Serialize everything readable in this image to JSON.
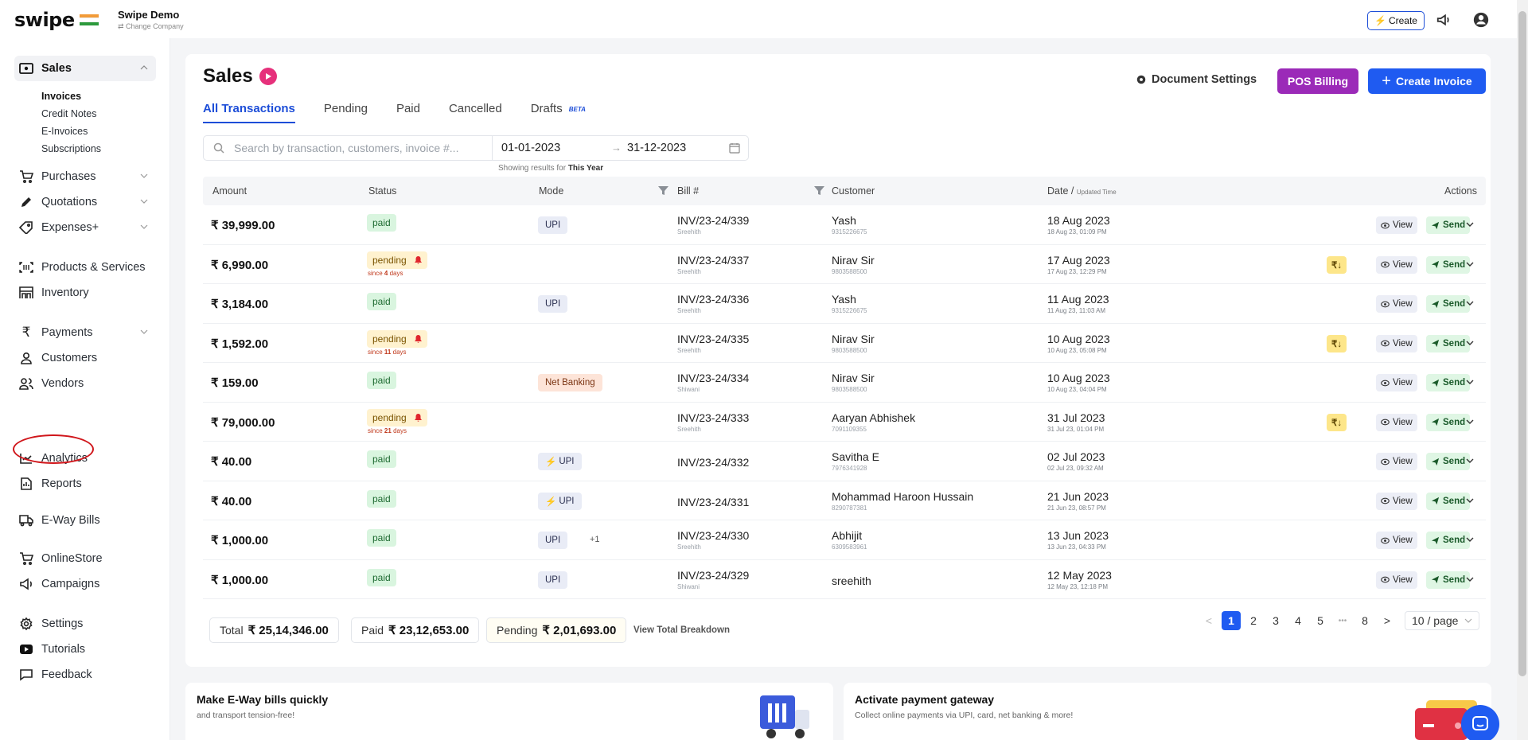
{
  "app": {
    "brand": "swipe",
    "company_name": "Swipe Demo",
    "change_company": "⇄ Change Company",
    "create_label": "Create"
  },
  "sidebar": {
    "sales": "Sales",
    "sales_sub": [
      "Invoices",
      "Credit Notes",
      "E-Invoices",
      "Subscriptions"
    ],
    "purchases": "Purchases",
    "quotations": "Quotations",
    "expenses": "Expenses+",
    "products": "Products & Services",
    "inventory": "Inventory",
    "payments": "Payments",
    "customers": "Customers",
    "vendors": "Vendors",
    "analytics": "Analytics",
    "reports": "Reports",
    "eway": "E-Way Bills",
    "onlinestore": "OnlineStore",
    "campaigns": "Campaigns",
    "settings": "Settings",
    "tutorials": "Tutorials",
    "feedback": "Feedback"
  },
  "header": {
    "title": "Sales",
    "doc_settings": "Document Settings",
    "pos_billing": "POS Billing",
    "create_invoice": "Create Invoice"
  },
  "tabs": {
    "all": "All Transactions",
    "pending": "Pending",
    "paid": "Paid",
    "cancelled": "Cancelled",
    "drafts": "Drafts",
    "beta": "BETA"
  },
  "filters": {
    "search_placeholder": "Search by transaction, customers, invoice #...",
    "date_from": "01-01-2023",
    "date_to": "31-12-2023",
    "showing_prefix": "Showing results for",
    "showing_value": "This Year"
  },
  "columns": {
    "amount": "Amount",
    "status": "Status",
    "mode": "Mode",
    "bill": "Bill #",
    "customer": "Customer",
    "date": "Date /",
    "date_sub": "Updated Time",
    "actions": "Actions"
  },
  "rows": [
    {
      "amount": "₹ 39,999.00",
      "status": "paid",
      "mode": "UPI",
      "bill": "INV/23-24/339",
      "bill_by": "Sreehith",
      "customer": "Yash",
      "phone": "9315226675",
      "date": "18 Aug 2023",
      "updated": "18 Aug 23, 01:09 PM"
    },
    {
      "amount": "₹ 6,990.00",
      "status": "pending",
      "since_pre": "since",
      "since_val": "4",
      "since_post": "days",
      "bill": "INV/23-24/337",
      "bill_by": "Sreehith",
      "customer": "Nirav Sir",
      "phone": "9803588500",
      "date": "17 Aug 2023",
      "updated": "17 Aug 23, 12:29 PM"
    },
    {
      "amount": "₹ 3,184.00",
      "status": "paid",
      "mode": "UPI",
      "bill": "INV/23-24/336",
      "bill_by": "Sreehith",
      "customer": "Yash",
      "phone": "9315226675",
      "date": "11 Aug 2023",
      "updated": "11 Aug 23, 11:03 AM"
    },
    {
      "amount": "₹ 1,592.00",
      "status": "pending",
      "since_pre": "since",
      "since_val": "11",
      "since_post": "days",
      "bill": "INV/23-24/335",
      "bill_by": "Sreehith",
      "customer": "Nirav Sir",
      "phone": "9803588500",
      "date": "10 Aug 2023",
      "updated": "10 Aug 23, 05:08 PM"
    },
    {
      "amount": "₹ 159.00",
      "status": "paid",
      "mode": "Net Banking",
      "bill": "INV/23-24/334",
      "bill_by": "Shiwani",
      "customer": "Nirav Sir",
      "phone": "9803588500",
      "date": "10 Aug 2023",
      "updated": "10 Aug 23, 04:04 PM"
    },
    {
      "amount": "₹ 79,000.00",
      "status": "pending",
      "since_pre": "since",
      "since_val": "21",
      "since_post": "days",
      "bill": "INV/23-24/333",
      "bill_by": "Sreehith",
      "customer": "Aaryan Abhishek",
      "phone": "7091109355",
      "date": "31 Jul 2023",
      "updated": "31 Jul 23, 01:04 PM"
    },
    {
      "amount": "₹ 40.00",
      "status": "paid",
      "mode": "UPI",
      "bill": "INV/23-24/332",
      "customer": "Savitha E",
      "phone": "7976341928",
      "date": "02 Jul 2023",
      "updated": "02 Jul 23, 09:32 AM"
    },
    {
      "amount": "₹ 40.00",
      "status": "paid",
      "mode": "UPI",
      "bill": "INV/23-24/331",
      "customer": "Mohammad Haroon Hussain",
      "phone": "8290787381",
      "date": "21 Jun 2023",
      "updated": "21 Jun 23, 08:57 PM"
    },
    {
      "amount": "₹ 1,000.00",
      "status": "paid",
      "mode": "UPI",
      "mode_extra": "+1",
      "bill": "INV/23-24/330",
      "bill_by": "Sreehith",
      "customer": "Abhijit",
      "phone": "6309583961",
      "date": "13 Jun 2023",
      "updated": "13 Jun 23, 04:33 PM"
    },
    {
      "amount": "₹ 1,000.00",
      "status": "paid",
      "mode": "UPI",
      "bill": "INV/23-24/329",
      "bill_by": "Shiwani",
      "customer": "sreehith",
      "date": "12 May 2023",
      "updated": "12 May 23, 12:18 PM"
    }
  ],
  "actions": {
    "view": "View",
    "send": "Send",
    "rupee": "₹↓"
  },
  "totals": {
    "total_label": "Total",
    "total": "₹ 25,14,346.00",
    "paid_label": "Paid",
    "paid": "₹ 23,12,653.00",
    "pending_label": "Pending",
    "pending": "₹ 2,01,693.00",
    "breakdown": "View Total Breakdown"
  },
  "pagination": {
    "pages": [
      "1",
      "2",
      "3",
      "4",
      "5",
      "•••",
      "8"
    ],
    "prev": "<",
    "next": ">",
    "page_size": "10 / page"
  },
  "promos": {
    "eway_title": "Make E-Way bills quickly",
    "eway_sub": "and transport tension-free!",
    "pg_title": "Activate payment gateway",
    "pg_sub": "Collect online payments via UPI, card, net banking & more!"
  },
  "colors": {
    "primary": "#1f5bf1",
    "pos": "#9b2ab8",
    "paid_bg": "#d9f5df",
    "pending_bg": "#fff2cf",
    "highlight_ring": "#d0161b"
  }
}
